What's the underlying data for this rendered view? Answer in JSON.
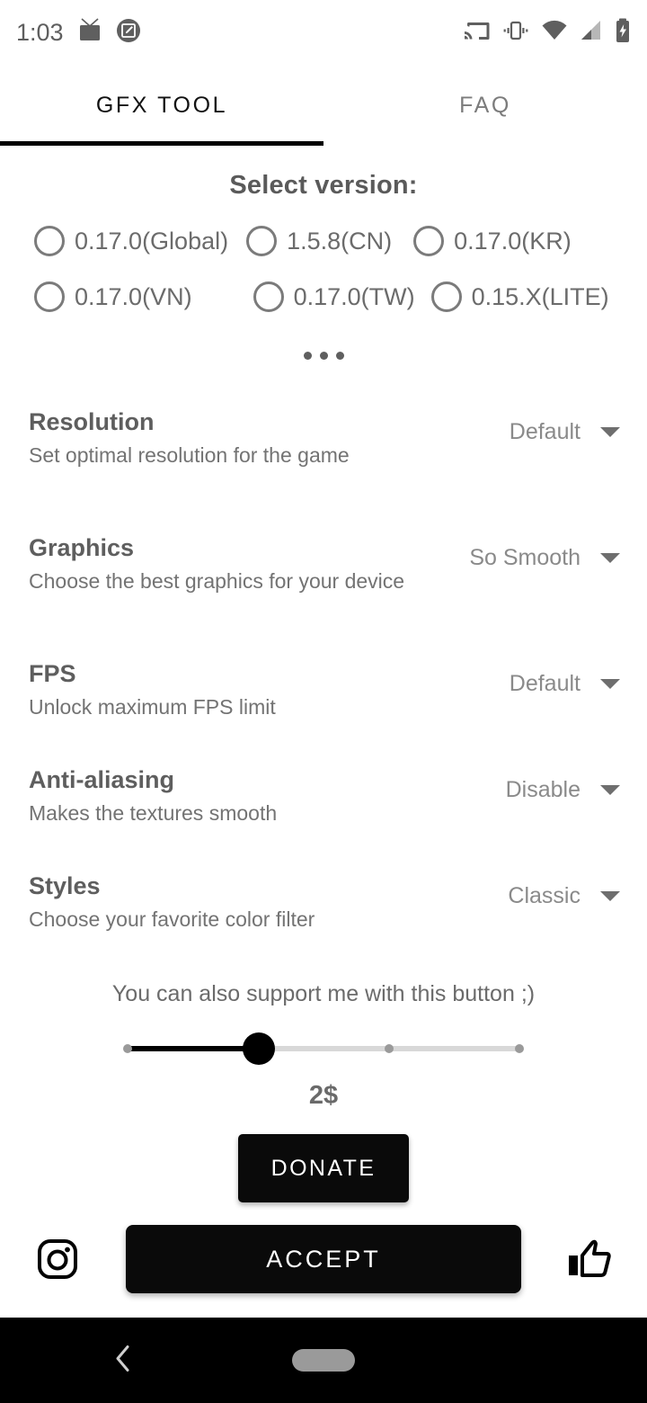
{
  "statusbar": {
    "time": "1:03",
    "left_icons": [
      "tv-icon",
      "screenshot-edit-icon"
    ],
    "right_icons": [
      "cast-icon",
      "vibrate-icon",
      "wifi-icon",
      "signal-icon",
      "battery-charging-icon"
    ]
  },
  "tabs": [
    {
      "label": "GFX TOOL",
      "active": true
    },
    {
      "label": "FAQ",
      "active": false
    }
  ],
  "version_section": {
    "title": "Select version:",
    "more_label": "•••",
    "options": [
      {
        "label": "0.17.0(Global)",
        "selected": false
      },
      {
        "label": "1.5.8(CN)",
        "selected": false
      },
      {
        "label": "0.17.0(KR)",
        "selected": false
      },
      {
        "label": "0.17.0(VN)",
        "selected": false
      },
      {
        "label": "0.17.0(TW)",
        "selected": false
      },
      {
        "label": "0.15.X(LITE)",
        "selected": false
      }
    ]
  },
  "settings": [
    {
      "title": "Resolution",
      "description": "Set optimal resolution for the game",
      "value": "Default"
    },
    {
      "title": "Graphics",
      "description": "Choose the best graphics for your device",
      "value": "So Smooth"
    },
    {
      "title": "FPS",
      "description": "Unlock maximum FPS limit",
      "value": "Default"
    },
    {
      "title": "Anti-aliasing",
      "description": "Makes the textures smooth",
      "value": "Disable"
    },
    {
      "title": "Styles",
      "description": "Choose your favorite color filter",
      "value": "Classic"
    }
  ],
  "donate": {
    "support_text": "You can also support me with this button ;)",
    "amount": "2$",
    "button_label": "DONATE",
    "slider": {
      "value": 2,
      "min": 1,
      "max": 4,
      "ticks": 4
    }
  },
  "bottom": {
    "instagram_icon": "instagram-icon",
    "accept_label": "ACCEPT",
    "thumbs_up_icon": "thumbs-up-icon"
  },
  "navbar": {
    "back_icon": "back-chevron-icon",
    "home_icon": "home-pill-icon"
  },
  "colors": {
    "accent": "#000000",
    "text_primary": "#5e5e5e",
    "text_secondary": "#8a8a8a",
    "background": "#ffffff",
    "navbar": "#000000"
  }
}
